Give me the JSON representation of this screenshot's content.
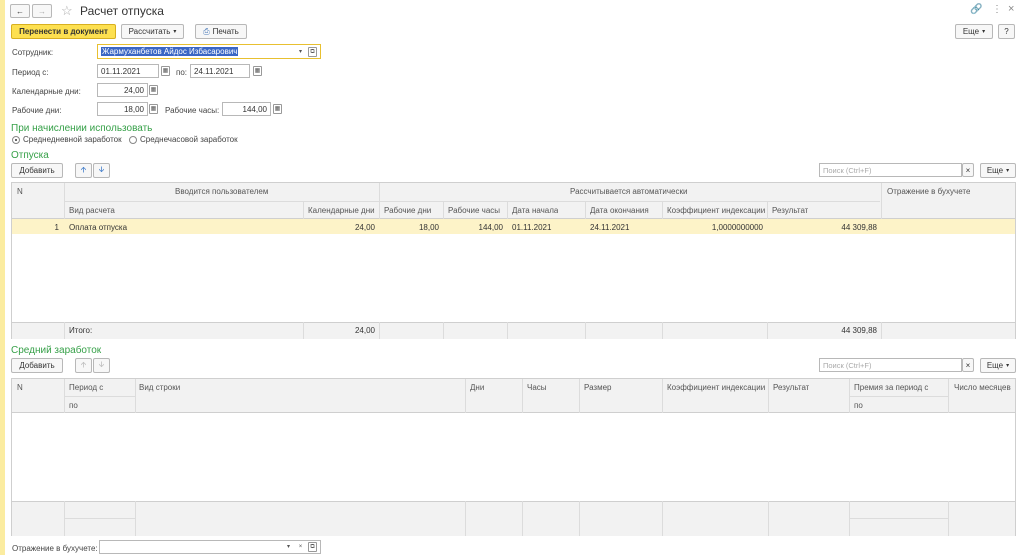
{
  "title": "Расчет отпуска",
  "toolbar": {
    "transfer": "Перенести в документ",
    "calculate": "Рассчитать",
    "print": "Печать",
    "more": "Еще",
    "help": "?"
  },
  "form": {
    "employee_label": "Сотрудник:",
    "employee_value": "Жармуханбетов Айдос Избасарович",
    "period_label": "Период с:",
    "period_from": "01.11.2021",
    "period_to_label": "по:",
    "period_to": "24.11.2021",
    "cal_days_label": "Календарные дни:",
    "cal_days": "24,00",
    "work_days_label": "Рабочие дни:",
    "work_days": "18,00",
    "work_hours_label": "Рабочие часы:",
    "work_hours": "144,00"
  },
  "accrual": {
    "title": "При начислении использовать",
    "opt1": "Среднедневной заработок",
    "opt2": "Среднечасовой заработок"
  },
  "vac": {
    "title": "Отпуска",
    "add": "Добавить",
    "search": "Поиск (Ctrl+F)",
    "more": "Еще",
    "h_n": "N",
    "h_user": "Вводится пользователем",
    "h_auto": "Рассчитывается автоматически",
    "h_acc": "Отражение в бухучете",
    "h_type": "Вид расчета",
    "h_cal": "Календарные дни",
    "h_wd": "Рабочие дни",
    "h_wh": "Рабочие часы",
    "h_start": "Дата начала",
    "h_end": "Дата окончания",
    "h_coef": "Коэффициент индексации",
    "h_res": "Результат",
    "row": {
      "n": "1",
      "type": "Оплата отпуска",
      "cal": "24,00",
      "wd": "18,00",
      "wh": "144,00",
      "start": "01.11.2021",
      "end": "24.11.2021",
      "coef": "1,0000000000",
      "res": "44 309,88"
    },
    "total_label": "Итого:",
    "total_cal": "24,00",
    "total_res": "44 309,88"
  },
  "avg": {
    "title": "Средний заработок",
    "add": "Добавить",
    "search": "Поиск (Ctrl+F)",
    "more": "Еще",
    "h_n": "N",
    "h_from": "Период с",
    "h_to": "по",
    "h_kind": "Вид строки",
    "h_days": "Дни",
    "h_hours": "Часы",
    "h_size": "Размер",
    "h_coef": "Коэффициент индексации",
    "h_res": "Результат",
    "h_bonus": "Премия за период с",
    "h_bonus_to": "по",
    "h_months": "Число месяцев"
  },
  "footer": {
    "acc_label": "Отражение в бухучете:"
  },
  "colors": {
    "accent": "#fde050",
    "section": "#36a048",
    "row_sel": "#fdf3c8"
  }
}
